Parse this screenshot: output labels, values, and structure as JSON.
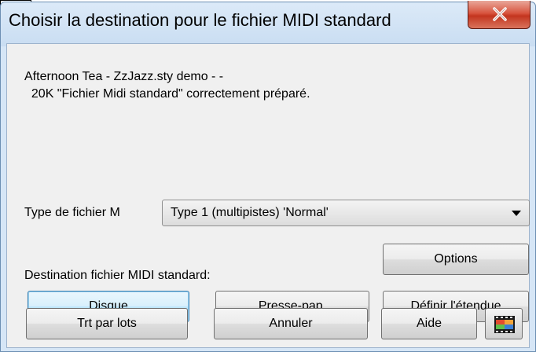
{
  "window": {
    "title": "Choisir la destination pour le fichier MIDI standard",
    "close_glyph": "X"
  },
  "message": {
    "line1": "Afternoon Tea - ZzJazz.sty demo - -",
    "line2": "  20K \"Fichier Midi standard\" correctement préparé."
  },
  "file_type": {
    "label": "Type de fichier M",
    "selected": "Type 1 (multipistes) 'Normal'"
  },
  "destination_label": "Destination fichier MIDI standard:",
  "buttons": {
    "options": "Options",
    "disk": "Disque",
    "clipboard": "Presse-pap.",
    "define_range": "Définir l'étendue",
    "batch": "Trt par lots",
    "cancel": "Annuler",
    "help": "Aide"
  },
  "icons": {
    "close": "close-icon",
    "dropdown": "chevron-down-icon",
    "film": "film-strip-icon"
  },
  "colors": {
    "frame": "#d6e6f6",
    "close_button": "#c3351f",
    "default_button": "#bee6fd"
  }
}
